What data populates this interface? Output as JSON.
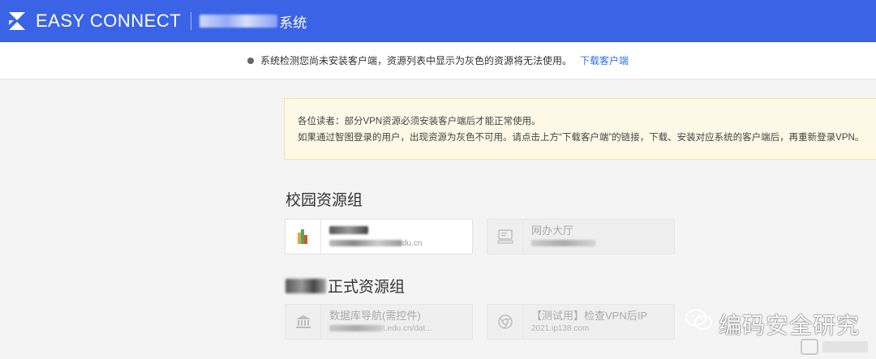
{
  "header": {
    "brand": "EASY CONNECT",
    "title_suffix": "系统"
  },
  "notice": {
    "message": "系统检测您尚未安装客户端，资源列表中显示为灰色的资源将无法使用。",
    "download_link": "下载客户端"
  },
  "alert": {
    "line1": "各位读者：部分VPN资源必须安装客户端后才能正常使用。",
    "line2": "如果通过智图登录的用户，出现资源为灰色不可用。请点击上方“下载客户端”的链接，下载、安装对应系统的客户端后，再重新登录VPN。"
  },
  "groups": [
    {
      "title": "校园资源组",
      "resources": [
        {
          "name": "",
          "url_tail": "du.cn",
          "icon": "colored-bars-icon",
          "enabled": true
        },
        {
          "name": "网办大厅",
          "url_tail": "",
          "icon": "terminal-icon",
          "enabled": false
        }
      ]
    },
    {
      "title": "正式资源组",
      "resources": [
        {
          "name": "数据库导航(需控件)",
          "url_tail": "t.edu.cn/dat...",
          "icon": "bank-icon",
          "enabled": false
        },
        {
          "name": "【测试用】检查VPN后IP",
          "url_tail": "2021.ip138.com",
          "icon": "chrome-icon",
          "enabled": false
        }
      ]
    }
  ],
  "watermark": {
    "text": "编码安全研究"
  },
  "colors": {
    "topbar": "#3a63e6",
    "link": "#2a73e8",
    "alert_bg": "#fdf9e6"
  }
}
